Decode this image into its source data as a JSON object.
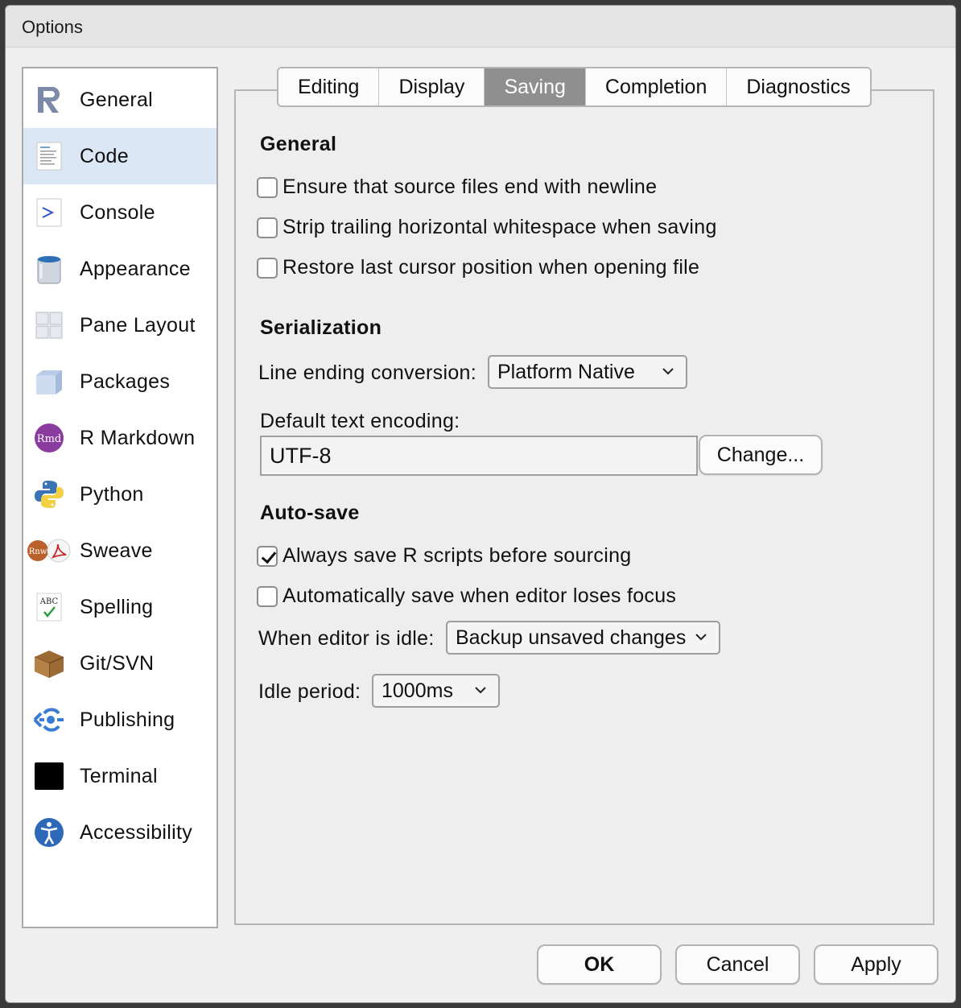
{
  "window": {
    "title": "Options"
  },
  "sidebar": {
    "items": [
      {
        "label": "General",
        "icon": "r-logo-icon",
        "selected": false
      },
      {
        "label": "Code",
        "icon": "code-document-icon",
        "selected": true
      },
      {
        "label": "Console",
        "icon": "console-prompt-icon",
        "selected": false
      },
      {
        "label": "Appearance",
        "icon": "paint-bucket-icon",
        "selected": false
      },
      {
        "label": "Pane Layout",
        "icon": "pane-layout-grid-icon",
        "selected": false
      },
      {
        "label": "Packages",
        "icon": "package-cube-icon",
        "selected": false
      },
      {
        "label": "R Markdown",
        "icon": "rmd-badge-icon",
        "selected": false
      },
      {
        "label": "Python",
        "icon": "python-logo-icon",
        "selected": false
      },
      {
        "label": "Sweave",
        "icon": "sweave-rnw-pdf-icon",
        "selected": false
      },
      {
        "label": "Spelling",
        "icon": "abc-check-icon",
        "selected": false
      },
      {
        "label": "Git/SVN",
        "icon": "git-box-icon",
        "selected": false
      },
      {
        "label": "Publishing",
        "icon": "publishing-icon",
        "selected": false
      },
      {
        "label": "Terminal",
        "icon": "terminal-black-square-icon",
        "selected": false
      },
      {
        "label": "Accessibility",
        "icon": "accessibility-person-icon",
        "selected": false
      }
    ],
    "rmd_badge_text": "Rmd",
    "rnw_badge_text": "Rnw",
    "abc_text": "ABC"
  },
  "tabs": [
    {
      "label": "Editing",
      "active": false
    },
    {
      "label": "Display",
      "active": false
    },
    {
      "label": "Saving",
      "active": true
    },
    {
      "label": "Completion",
      "active": false
    },
    {
      "label": "Diagnostics",
      "active": false
    }
  ],
  "general": {
    "title": "General",
    "options": [
      {
        "label": "Ensure that source files end with newline",
        "checked": false
      },
      {
        "label": "Strip trailing horizontal whitespace when saving",
        "checked": false
      },
      {
        "label": "Restore last cursor position when opening file",
        "checked": false
      }
    ]
  },
  "serialization": {
    "title": "Serialization",
    "line_ending_label": "Line ending conversion:",
    "line_ending_value": "Platform Native",
    "encoding_label": "Default text encoding:",
    "encoding_value": "UTF-8",
    "change_button": "Change..."
  },
  "autosave": {
    "title": "Auto-save",
    "options": [
      {
        "label": "Always save R scripts before sourcing",
        "checked": true
      },
      {
        "label": "Automatically save when editor loses focus",
        "checked": false
      }
    ],
    "idle_label": "When editor is idle:",
    "idle_value": "Backup unsaved changes",
    "period_label": "Idle period:",
    "period_value": "1000ms"
  },
  "footer": {
    "ok": "OK",
    "cancel": "Cancel",
    "apply": "Apply"
  },
  "colors": {
    "selected_bg": "#dbe7f5",
    "active_tab": "#8f8f8f",
    "publishing_blue": "#3a7bd5"
  }
}
